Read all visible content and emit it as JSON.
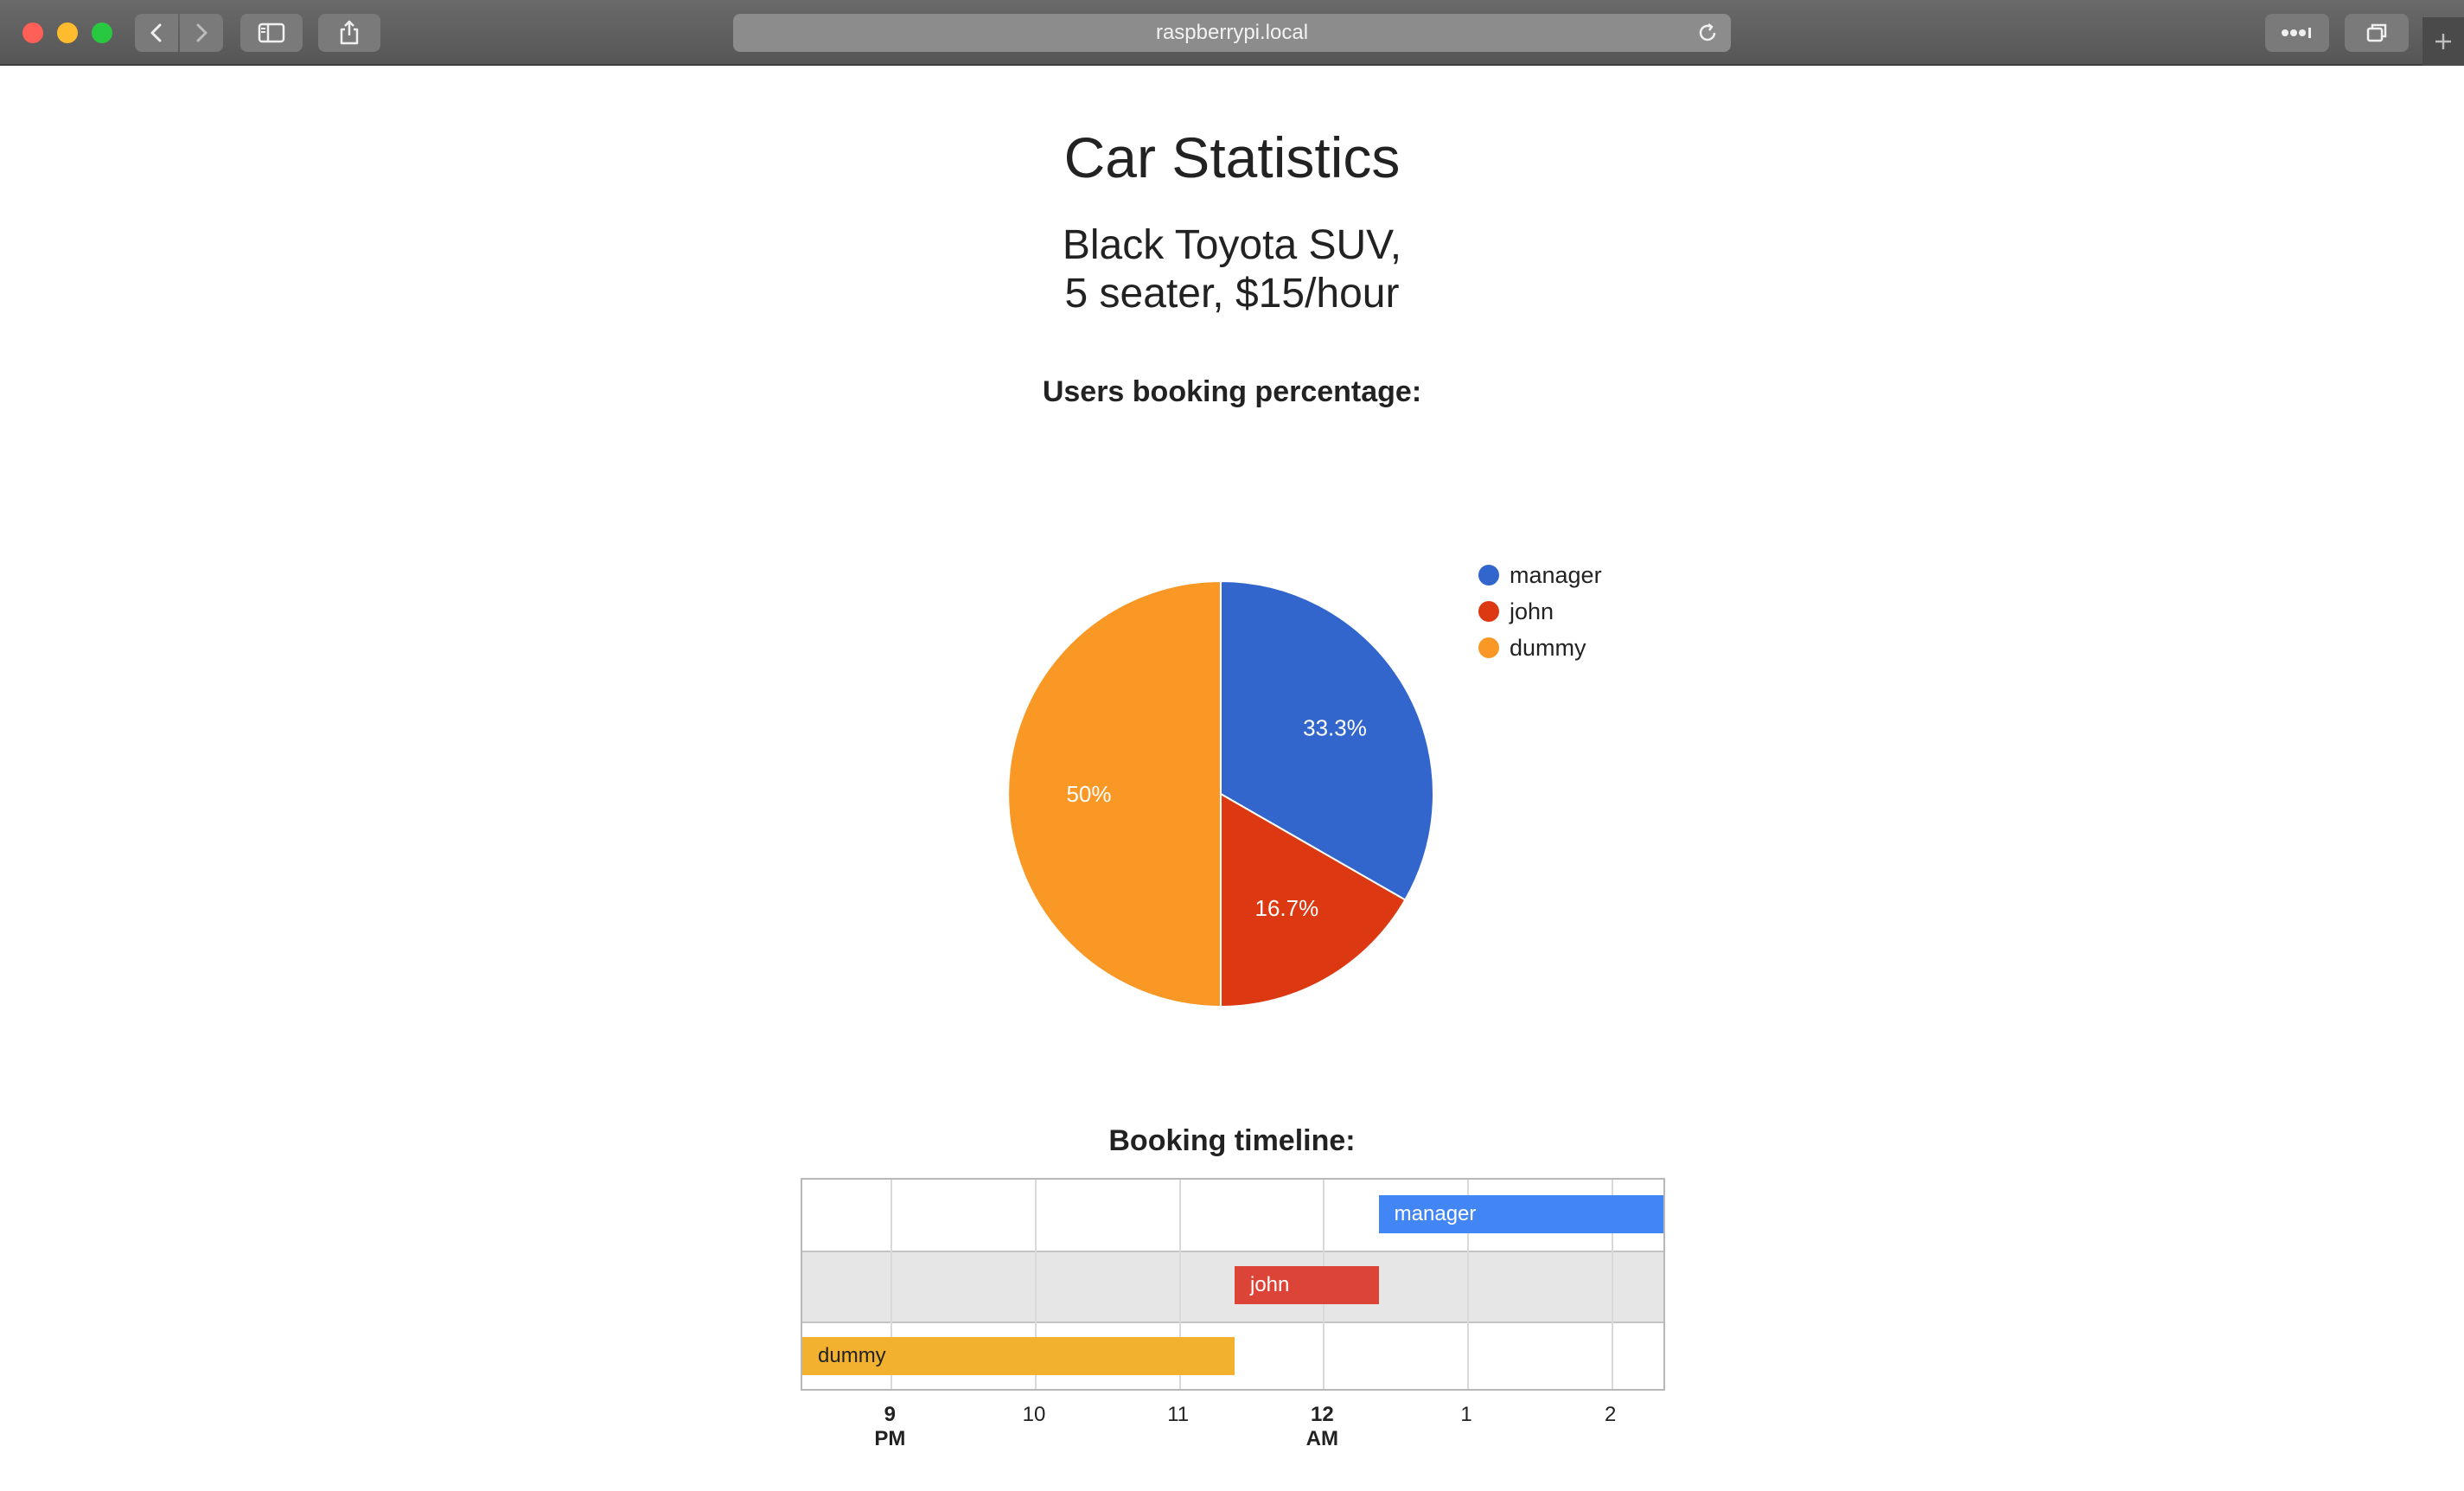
{
  "browser": {
    "address": "raspberrypi.local",
    "icons": {
      "back": "chevron-left-icon",
      "forward": "chevron-right-icon",
      "sidebar": "sidebar-icon",
      "share": "share-icon",
      "reload": "reload-icon",
      "more": "more-icon",
      "tabs": "tabs-overview-icon",
      "new_tab": "plus-icon"
    }
  },
  "page": {
    "title": "Car Statistics",
    "subtitle_line1": "Black Toyota SUV,",
    "subtitle_line2": "5 seater, $15/hour",
    "pie_heading": "Users booking percentage:",
    "timeline_heading": "Booking timeline:"
  },
  "chart_data": [
    {
      "type": "pie",
      "title": "",
      "legend_position": "right",
      "slices": [
        {
          "label": "manager",
          "value": 33.3,
          "display": "33.3%",
          "color": "#3366cc"
        },
        {
          "label": "john",
          "value": 16.7,
          "display": "16.7%",
          "color": "#dc3912"
        },
        {
          "label": "dummy",
          "value": 50,
          "display": "50%",
          "color": "#fa9826"
        }
      ]
    },
    {
      "type": "timeline",
      "title": "",
      "x_axis_ticks": [
        {
          "hour": 21,
          "label": "9",
          "sub": "PM",
          "bold": true
        },
        {
          "hour": 22,
          "label": "10",
          "sub": "",
          "bold": false
        },
        {
          "hour": 23,
          "label": "11",
          "sub": "",
          "bold": false
        },
        {
          "hour": 24,
          "label": "12",
          "sub": "AM",
          "bold": true
        },
        {
          "hour": 25,
          "label": "1",
          "sub": "",
          "bold": false
        },
        {
          "hour": 26,
          "label": "2",
          "sub": "",
          "bold": false
        }
      ],
      "x_range_hours": [
        20.38,
        26.38
      ],
      "rows": [
        {
          "label": "manager",
          "start_hour": 24.38,
          "end_hour": 26.38,
          "color": "#4285f4"
        },
        {
          "label": "john",
          "start_hour": 23.38,
          "end_hour": 24.38,
          "color": "#db4437"
        },
        {
          "label": "dummy",
          "start_hour": 20.38,
          "end_hour": 23.38,
          "color": "#f2b230"
        }
      ]
    }
  ]
}
